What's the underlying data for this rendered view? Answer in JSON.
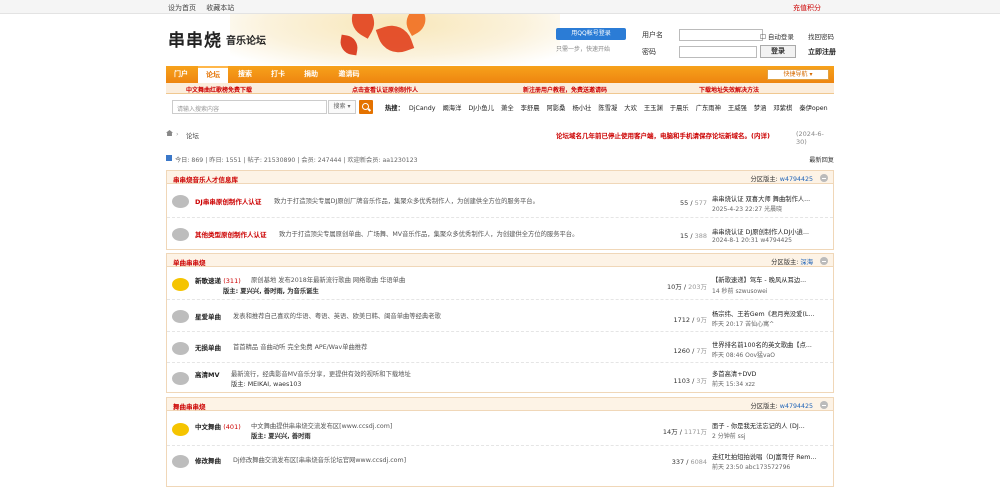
{
  "top": {
    "set_home": "设为首页",
    "bookmark": "收藏本站",
    "recharge": "充值积分"
  },
  "header": {
    "logo": "串串烧",
    "logo_sub": "音乐论坛",
    "qq_login": "用QQ帐号登录",
    "qq_hint": "只需一步，快速开始",
    "username_label": "用户名",
    "password_label": "密码",
    "auto_login": "自动登录",
    "find_password": "找回密码",
    "login_btn": "登录",
    "register": "立即注册"
  },
  "nav": {
    "items": [
      {
        "label": "门户"
      },
      {
        "label": "论坛"
      },
      {
        "label": "搜索"
      },
      {
        "label": "打卡"
      },
      {
        "label": "捐助"
      },
      {
        "label": "邀请码"
      }
    ],
    "quick": "快捷导航"
  },
  "promo": [
    "中文舞曲红歌榜免费下载",
    "点击查看认证原创制作人",
    "新注册用户教程，免费送邀请码",
    "下载地址失效解决方法"
  ],
  "search": {
    "placeholder": "请输入搜索内容",
    "type": "搜索",
    "hot_label": "热搜：",
    "hot": [
      "DjCandy",
      "阚海洋",
      "DJ小鱼儿",
      "萧全",
      "李舒晨",
      "阿影桑",
      "杨小壮",
      "陈雪凝",
      "大欢",
      "王玉渊",
      "于晨乐",
      "广东雨神",
      "王威强",
      "梦涵",
      "邓紫棋",
      "秦伊open"
    ]
  },
  "crumbs": {
    "current": "论坛",
    "notice": "论坛域名几年前已停止使用客户端，电脑和手机请保存论坛新域名。(内详)",
    "date": "(2024-6-30)"
  },
  "stats": {
    "text": "今日: 869 | 昨日: 1551 | 帖子: 21530890 | 会员: 247444 | 欢迎新会员: aa1230123",
    "latest": "最新回复"
  },
  "sections": [
    {
      "title": "串串烧音乐人才信息库",
      "mod_label": "分区版主: ",
      "mod": "w4794425",
      "rows": [
        {
          "name": "DJ串串原创制作人认证",
          "red": true,
          "new": "",
          "desc": "致力于打造顶尖专属DJ原创厂牌音乐作品，集聚众多优秀制作人，为创建供全方位的服务平台。",
          "mods": "",
          "count": "55",
          "total": "577",
          "last1": "串串烧认证 双喜大师 舞曲制作人...",
          "last2": "2025-4-23 22:27 光晨晓"
        },
        {
          "name": "其他类型原创制作人认证",
          "red": true,
          "new": "",
          "desc": "致力于打造顶尖专属原创单曲、广场舞、MV音乐作品，集聚众多优秀制作人，为创建供全方位的服务平台。",
          "mods": "",
          "count": "15",
          "total": "388",
          "last1": "串串烧认证 DJ原创制作人DJ小逍...",
          "last2": "2024-8-1 20:31 w4794425"
        }
      ]
    },
    {
      "title": "单曲串串烧",
      "mod_label": "分区版主: ",
      "mod": "深海",
      "rows": [
        {
          "name": "新歌速递",
          "red": false,
          "new": "(311)",
          "desc": "原创基地 发布2018年最新流行歌曲 网络歌曲 华语单曲",
          "mods": "版主: 夏兴兴, 善时雨, 为音乐诞生",
          "count": "10万",
          "total": "203万",
          "last1": "【新歌速递】驾车 - 晚风从耳边...",
          "last2": "14 秒前 szwusowei"
        },
        {
          "name": "星爱单曲",
          "red": false,
          "new": "",
          "desc": "发表和推荐自己喜欢的华语、粤语、英语、欧美日韩、闽音单曲等经典老歌",
          "mods": "",
          "count": "1712",
          "total": "9万",
          "last1": "杨宗纬、王若Gem《君月亮没爱(L...",
          "last2": "昨天 20:17 苦仙心寓^"
        },
        {
          "name": "无损单曲",
          "red": false,
          "new": "",
          "desc": "首首精品 音曲动听 完全免费 APE/Wav单曲推荐",
          "mods": "",
          "count": "1260",
          "total": "7万",
          "last1": "世界排名前100名的英文歌曲【点...",
          "last2": "昨天 08:46 Oov猛vaO"
        },
        {
          "name": "高清MV",
          "red": false,
          "new": "",
          "desc": "最新流行，经典影音MV音乐分享，更提供有效的视听和下载地址",
          "mods": "版主: MEIKAI, waes103",
          "count": "1103",
          "total": "3万",
          "last1": "多首高清+DVD",
          "last2": "前天 15:34 xzz"
        }
      ]
    },
    {
      "title": "舞曲串串烧",
      "mod_label": "分区版主: ",
      "mod": "w4794425",
      "rows": [
        {
          "name": "中文舞曲",
          "red": false,
          "new": "(401)",
          "desc": "中文舞曲提供串串烧交流发布区[www.ccsdj.com]",
          "mods": "版主: 夏兴兴, 善时雨",
          "count": "14万",
          "total": "1171万",
          "last1": "面子 - 你是我无法忘记的人 (DJ...",
          "last2": "2 分钟前 ssj"
        },
        {
          "name": "修改舞曲",
          "red": false,
          "new": "",
          "desc": "Dj修改舞曲交流发布区[串串烧音乐论坛官网www.ccsdj.com]",
          "mods": "",
          "count": "337",
          "total": "6084",
          "last1": "走红吐拍短拍说唱（DJ富哥仔 Rem...",
          "last2": "前天 23:50 abc173572796"
        }
      ]
    }
  ]
}
